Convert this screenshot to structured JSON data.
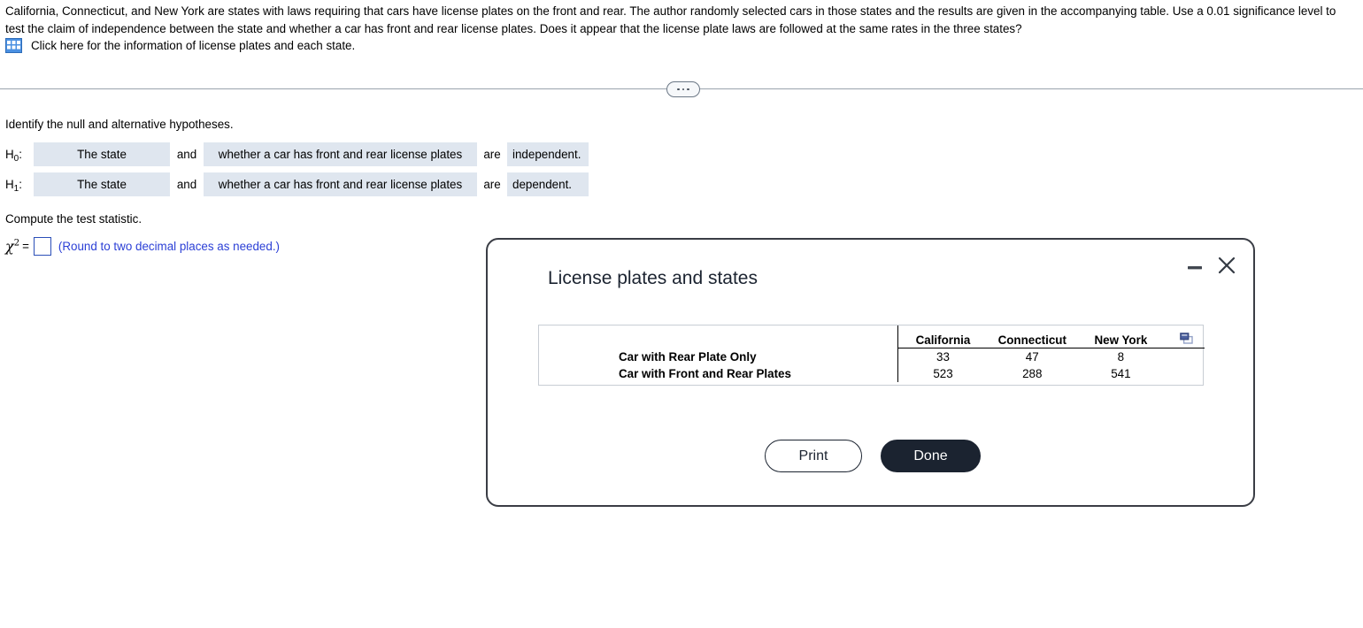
{
  "problem": {
    "statement": "California, Connecticut, and New York are states with laws requiring that cars have license plates on the front and rear. The author randomly selected cars in those states and the results are given in the accompanying table. Use a 0.01 significance level to test the claim of independence between the state and whether a car has front and rear license plates. Does it appear that the license plate laws are followed at the same rates in the three states?",
    "table_link_label": "Click here for the information of license plates and each state.",
    "table_link_icon": "grid-table-icon"
  },
  "divider": {
    "ellipsis_icon": "ellipsis-pill-icon"
  },
  "hypotheses": {
    "heading": "Identify the null and alternative hypotheses.",
    "word_and": "and",
    "word_are": "are",
    "rows": [
      {
        "label_base": "H",
        "label_sub": "0",
        "label_colon": ":",
        "subject": "The state",
        "object": "whether a car has front and rear license plates",
        "verdict": "independent."
      },
      {
        "label_base": "H",
        "label_sub": "1",
        "label_colon": ":",
        "subject": "The state",
        "object": "whether a car has front and rear license plates",
        "verdict": "dependent."
      }
    ]
  },
  "test_statistic": {
    "heading": "Compute the test statistic.",
    "symbol": "χ",
    "exponent": "2",
    "equals": "=",
    "input_value": "",
    "hint": "(Round to two decimal places as needed.)",
    "hint_color": "#2b3fd6"
  },
  "modal": {
    "title": "License plates and states",
    "minimize_icon": "minimize-icon",
    "close_icon": "close-icon",
    "copy_icon": "copy-icon",
    "print_label": "Print",
    "done_label": "Done",
    "done_bg_color": "#1b2330"
  },
  "chart_data": {
    "type": "table",
    "title": "License plates and states",
    "columns": [
      "",
      "California",
      "Connecticut",
      "New York"
    ],
    "rows": [
      {
        "label": "Car with Rear Plate Only",
        "values": [
          33,
          47,
          8
        ]
      },
      {
        "label": "Car with Front and Rear Plates",
        "values": [
          523,
          288,
          541
        ]
      }
    ]
  }
}
